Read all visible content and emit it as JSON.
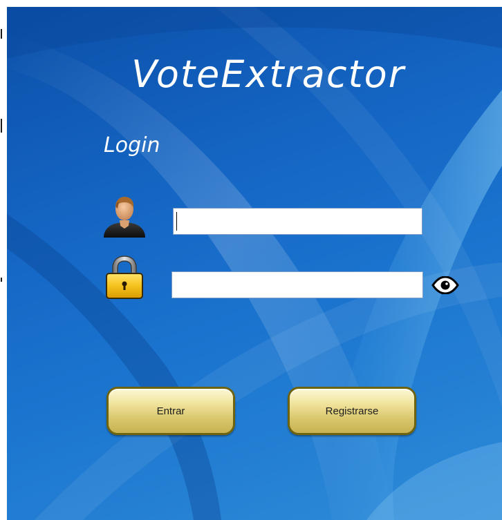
{
  "app": {
    "title": "VoteExtractor",
    "subtitle": "Login"
  },
  "form": {
    "username_value": "",
    "password_value": "",
    "username_icon": "user-icon",
    "password_icon": "lock-icon",
    "show_password_icon": "eye-icon"
  },
  "buttons": {
    "enter_label": "Entrar",
    "register_label": "Registrarse"
  },
  "colors": {
    "background": "#1566c4",
    "button_fill": "#efe29a",
    "button_border": "#6e6410",
    "text": "#ffffff"
  }
}
